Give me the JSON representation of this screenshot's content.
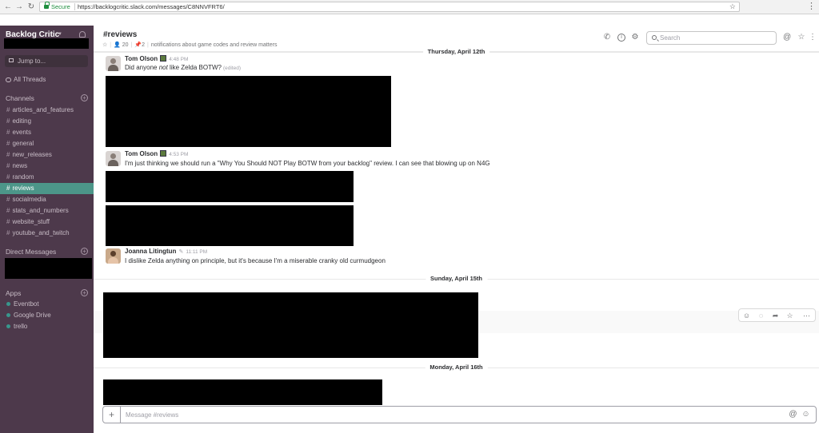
{
  "browser": {
    "secure_label": "Secure",
    "url": "https://backlogcritic.slack.com/messages/C8NNVFRT6/"
  },
  "sidebar": {
    "team_name": "Backlog Critic",
    "jump_to": "Jump to...",
    "all_threads": "All Threads",
    "channels_title": "Channels",
    "channels": [
      "articles_and_features",
      "editing",
      "events",
      "general",
      "new_releases",
      "news",
      "random",
      "reviews",
      "socialmedia",
      "stats_and_numbers",
      "website_stuff",
      "youtube_and_twitch"
    ],
    "active_channel": "reviews",
    "dm_title": "Direct Messages",
    "apps_title": "Apps",
    "apps": [
      "Eventbot",
      "Google Drive",
      "trello"
    ]
  },
  "header": {
    "channel": "#reviews",
    "members": "20",
    "pins": "2",
    "topic": "notifications about game codes and review matters",
    "search_placeholder": "Search"
  },
  "days": {
    "d1": "Thursday, April 12th",
    "d2": "Sunday, April 15th",
    "d3": "Monday, April 16th"
  },
  "messages": [
    {
      "author": "Tom Olson",
      "time": "4:48 PM",
      "text_pre": "Did anyone ",
      "text_em": "not",
      "text_post": " like Zelda BOTW?",
      "edited": "(edited)"
    },
    {
      "author": "Tom Olson",
      "time": "4:53 PM",
      "text": "I'm just thinking we should run a \"Why You Should NOT Play BOTW from your backlog\" review. I can see that blowing up on N4G"
    },
    {
      "author": "Joanna Litingtun",
      "time": "11:11 PM",
      "text": "I dislike Zelda anything on principle, but it's because I'm a miserable cranky old curmudgeon"
    }
  ],
  "composer": {
    "placeholder": "Message #reviews"
  },
  "colors": {
    "sidebar_bg": "#4d394b",
    "active_channel_bg": "#4c9689",
    "presence_dot": "#38978d"
  }
}
